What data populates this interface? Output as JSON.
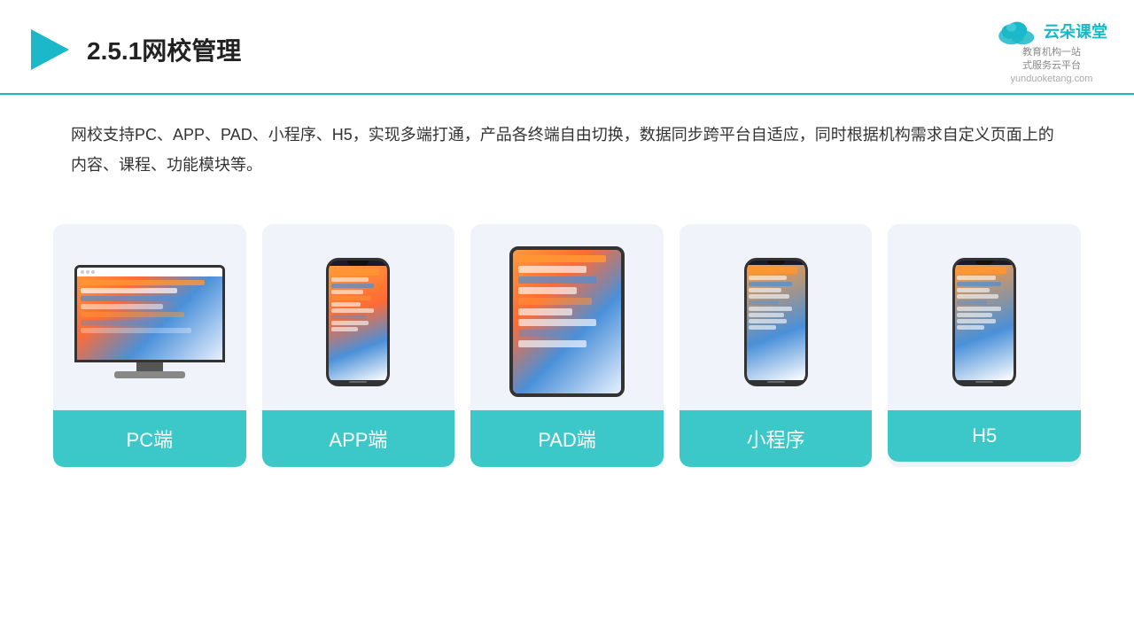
{
  "header": {
    "title": "2.5.1网校管理",
    "brand_name": "云朵课堂",
    "brand_sub": "教育机构一站\n式服务云平台",
    "brand_url": "yunduoketang.com"
  },
  "description": {
    "text": "网校支持PC、APP、PAD、小程序、H5，实现多端打通，产品各终端自由切换，数据同步跨平台自适应，同时根据机构需求自定义页面上的内容、课程、功能模块等。"
  },
  "cards": [
    {
      "id": "pc",
      "label": "PC端"
    },
    {
      "id": "app",
      "label": "APP端"
    },
    {
      "id": "pad",
      "label": "PAD端"
    },
    {
      "id": "miniprogram",
      "label": "小程序"
    },
    {
      "id": "h5",
      "label": "H5"
    }
  ]
}
